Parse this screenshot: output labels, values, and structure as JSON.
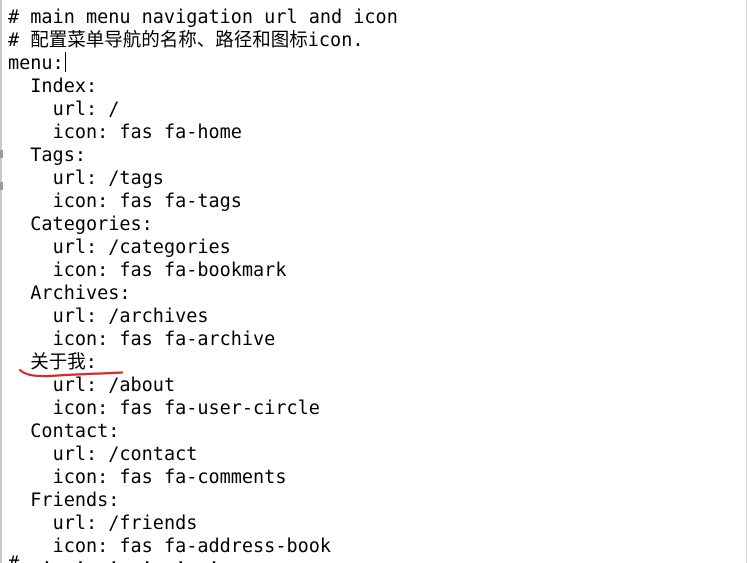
{
  "editor": {
    "lines": [
      {
        "indent": "",
        "text": "# main menu navigation url and icon"
      },
      {
        "indent": "",
        "text": "# 配置菜单导航的名称、路径和图标icon."
      },
      {
        "indent": "",
        "text": "menu:"
      },
      {
        "indent": "  ",
        "text": "Index:"
      },
      {
        "indent": "    ",
        "text": "url: /"
      },
      {
        "indent": "    ",
        "text": "icon: fas fa-home"
      },
      {
        "indent": "  ",
        "text": "Tags:"
      },
      {
        "indent": "    ",
        "text": "url: /tags"
      },
      {
        "indent": "    ",
        "text": "icon: fas fa-tags"
      },
      {
        "indent": "  ",
        "text": "Categories:"
      },
      {
        "indent": "    ",
        "text": "url: /categories"
      },
      {
        "indent": "    ",
        "text": "icon: fas fa-bookmark"
      },
      {
        "indent": "  ",
        "text": "Archives:"
      },
      {
        "indent": "    ",
        "text": "url: /archives"
      },
      {
        "indent": "    ",
        "text": "icon: fas fa-archive"
      },
      {
        "indent": "  ",
        "text": "关于我:"
      },
      {
        "indent": "    ",
        "text": "url: /about"
      },
      {
        "indent": "    ",
        "text": "icon: fas fa-user-circle"
      },
      {
        "indent": "  ",
        "text": "Contact:"
      },
      {
        "indent": "    ",
        "text": "url: /contact"
      },
      {
        "indent": "    ",
        "text": "icon: fas fa-comments"
      },
      {
        "indent": "  ",
        "text": "Friends:"
      },
      {
        "indent": "    ",
        "text": "url: /friends"
      },
      {
        "indent": "    ",
        "text": "icon: fas fa-address-book"
      }
    ],
    "caret_line": 2
  },
  "annotation": {
    "color": "#d62a2a",
    "target_line": 15
  }
}
